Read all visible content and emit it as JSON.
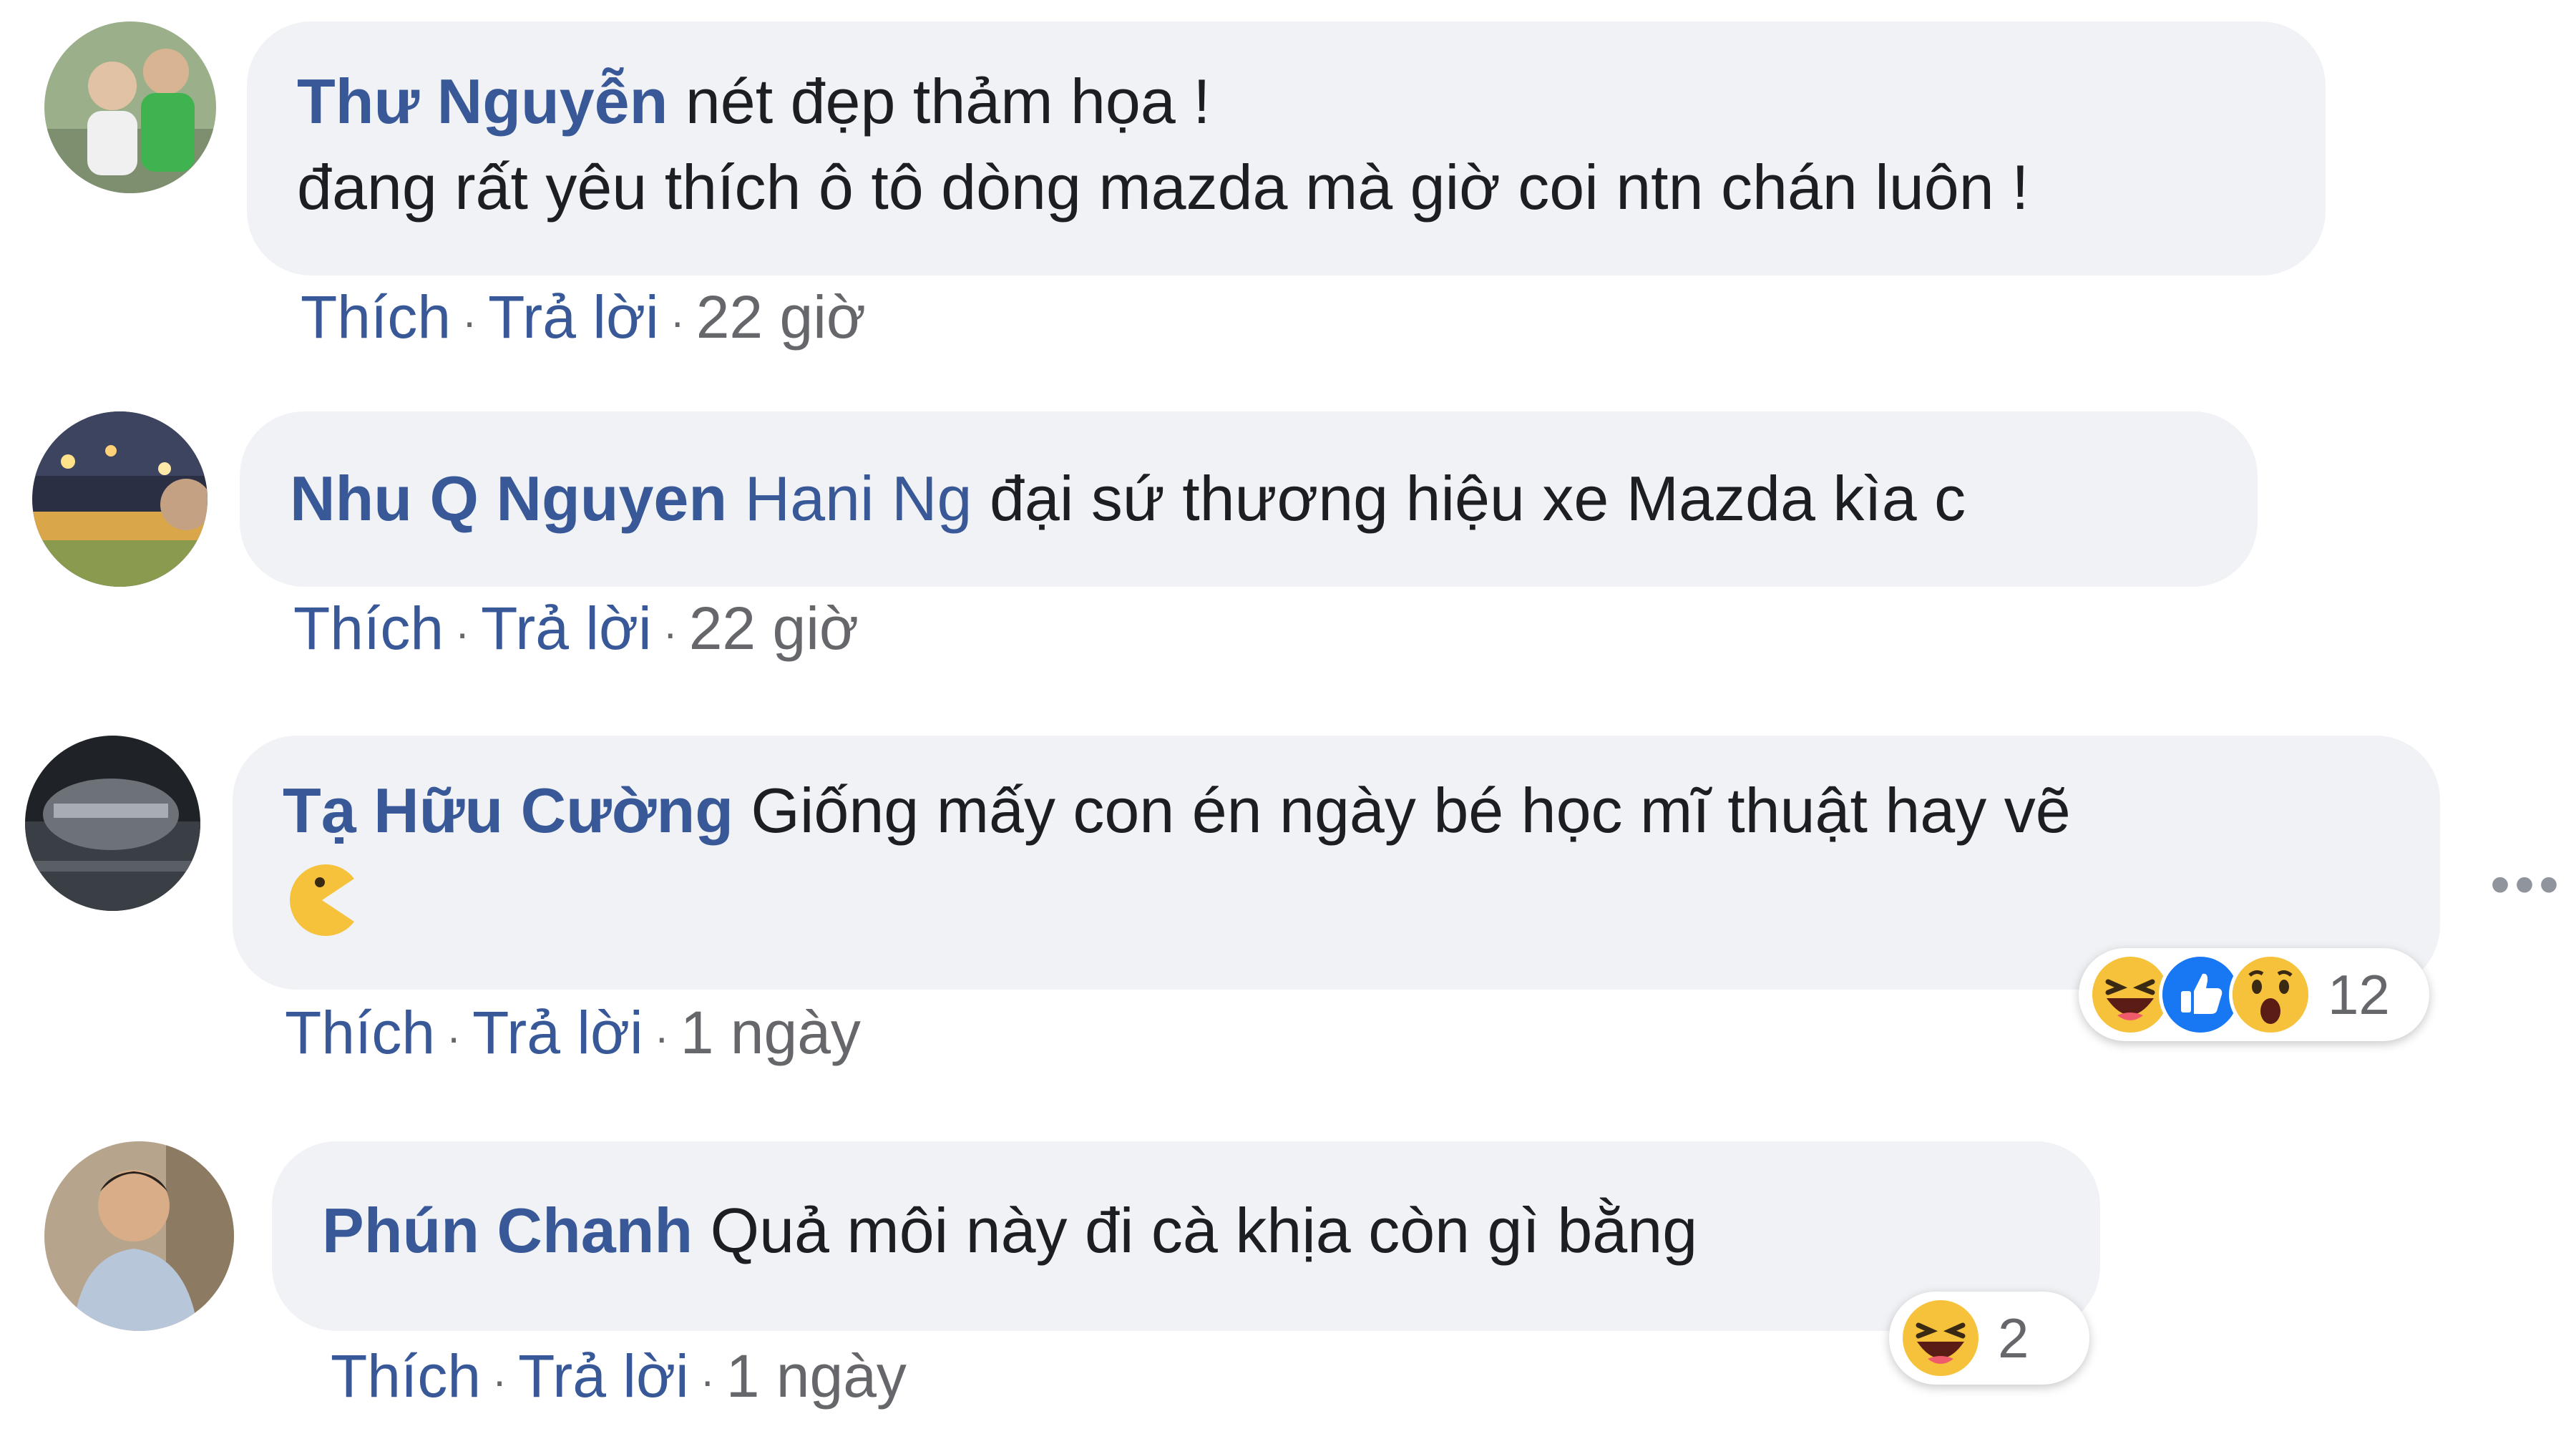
{
  "comments": [
    {
      "author": "Thư Nguyễn",
      "text_line1": " nét đẹp thảm họa !",
      "text_line2": "đang rất yêu thích ô tô dòng mazda mà giờ coi ntn chán luôn !",
      "like_label": "Thích",
      "reply_label": "Trả lời",
      "time": "22 giờ"
    },
    {
      "author": "Nhu Q Nguyen",
      "tag": "Hani Ng",
      "text": "đại sứ thương hiệu xe Mazda kìa c",
      "like_label": "Thích",
      "reply_label": "Trả lời",
      "time": "22 giờ"
    },
    {
      "author": "Tạ Hữu Cường",
      "text": " Giống mấy con én ngày bé học mĩ thuật hay vẽ",
      "emoji_icon": "pacman-emoji-icon",
      "like_label": "Thích",
      "reply_label": "Trả lời",
      "time": "1 ngày",
      "reactions": [
        "haha-icon",
        "like-icon",
        "wow-icon"
      ],
      "reaction_count": "12",
      "more_label": "•••"
    },
    {
      "author": "Phún Chanh",
      "text": " Quả môi này đi cà khịa còn gì bằng",
      "like_label": "Thích",
      "reply_label": "Trả lời",
      "time": "1 ngày",
      "reactions": [
        "haha-icon"
      ],
      "reaction_count": "2"
    }
  ],
  "separator": "·",
  "colors": {
    "link": "#385898",
    "bubble": "#f0f2f5",
    "text": "#1c1e21",
    "meta": "#65676b",
    "like_blue": "#1877f2",
    "reaction_yellow": "#f7c23b"
  }
}
